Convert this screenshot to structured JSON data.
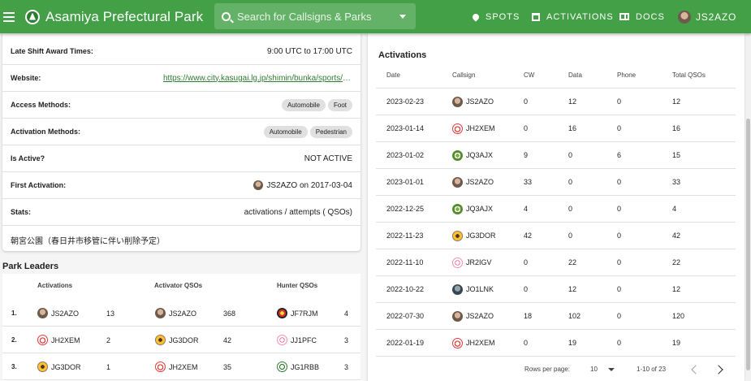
{
  "appbar": {
    "title": "Asamiya Prefectural Park",
    "search_placeholder": "Search for Callsigns & Parks",
    "nav": {
      "spots": "SPOTS",
      "activations": "ACTIVATIONS",
      "docs": "DOCS",
      "user": "JS2AZO"
    }
  },
  "details": {
    "rows": [
      {
        "label": "Late Shift Award Times:",
        "value": "9:00 UTC to 17:00 UTC"
      },
      {
        "label": "Website:",
        "link": "https://www.city.kasugai.lg.jp/shimin/bunka/sports/asamiya/index.html"
      },
      {
        "label": "Access Methods:",
        "chips": [
          "Automobile",
          "Foot"
        ]
      },
      {
        "label": "Activation Methods:",
        "chips": [
          "Automobile",
          "Pedestrian"
        ]
      },
      {
        "label": "Is Active?",
        "value": "NOT ACTIVE"
      },
      {
        "label": "First Activation:",
        "value": "JS2AZO on 2017-03-04"
      },
      {
        "label": "Stats:",
        "value": "activations / attempts ( QSOs)"
      }
    ],
    "note": "朝宮公園（春日井市移管に伴い削除予定）"
  },
  "leaders": {
    "title": "Park Leaders",
    "headers": {
      "activations": "Activations",
      "activator_qsos": "Activator QSOs",
      "hunter_qsos": "Hunter QSOs"
    },
    "rows": [
      {
        "rank": "1.",
        "act_call": "JS2AZO",
        "act_icon": "av-photo",
        "act_count": "13",
        "aq_call": "JS2AZO",
        "aq_icon": "av-photo",
        "aq_count": "368",
        "hq_call": "JF7RJM",
        "hq_icon": "av-dark",
        "hq_count": "4"
      },
      {
        "rank": "2.",
        "act_call": "JH2XEM",
        "act_icon": "av-red",
        "act_count": "2",
        "aq_call": "JG3DOR",
        "aq_icon": "av-gold",
        "aq_count": "42",
        "hq_call": "JJ1PFC",
        "hq_icon": "av-pink",
        "hq_count": "3"
      },
      {
        "rank": "3.",
        "act_call": "JG3DOR",
        "act_icon": "av-gold",
        "act_count": "1",
        "aq_call": "JH2XEM",
        "aq_icon": "av-red",
        "aq_count": "35",
        "hq_call": "JG1RBB",
        "hq_icon": "av-teal",
        "hq_count": "3"
      }
    ]
  },
  "activations": {
    "title": "Activations",
    "headers": {
      "date": "Date",
      "callsign": "Callsign",
      "cw": "CW",
      "data": "Data",
      "phone": "Phone",
      "total": "Total QSOs"
    },
    "rows": [
      {
        "date": "2023-02-23",
        "call": "JS2AZO",
        "icon": "av-photo",
        "cw": "0",
        "data": "12",
        "phone": "0",
        "total": "12"
      },
      {
        "date": "2023-01-14",
        "call": "JH2XEM",
        "icon": "av-red",
        "cw": "0",
        "data": "16",
        "phone": "0",
        "total": "16"
      },
      {
        "date": "2023-01-02",
        "call": "JQ3AJX",
        "icon": "av-green",
        "cw": "9",
        "data": "0",
        "phone": "6",
        "total": "15"
      },
      {
        "date": "2023-01-01",
        "call": "JS2AZO",
        "icon": "av-photo",
        "cw": "33",
        "data": "0",
        "phone": "0",
        "total": "33"
      },
      {
        "date": "2022-12-25",
        "call": "JQ3AJX",
        "icon": "av-green",
        "cw": "4",
        "data": "0",
        "phone": "0",
        "total": "4"
      },
      {
        "date": "2022-11-23",
        "call": "JG3DOR",
        "icon": "av-gold",
        "cw": "42",
        "data": "0",
        "phone": "0",
        "total": "42"
      },
      {
        "date": "2022-11-10",
        "call": "JR2IGV",
        "icon": "av-pink",
        "cw": "0",
        "data": "22",
        "phone": "0",
        "total": "22"
      },
      {
        "date": "2022-10-22",
        "call": "JO1LNK",
        "icon": "av-blue",
        "cw": "0",
        "data": "12",
        "phone": "0",
        "total": "12"
      },
      {
        "date": "2022-07-30",
        "call": "JS2AZO",
        "icon": "av-photo",
        "cw": "18",
        "data": "102",
        "phone": "0",
        "total": "120"
      },
      {
        "date": "2022-01-19",
        "call": "JH2XEM",
        "icon": "av-red",
        "cw": "0",
        "data": "19",
        "phone": "0",
        "total": "19"
      }
    ],
    "footer": {
      "rows_per_page_label": "Rows per page:",
      "rows_per_page": "10",
      "range": "1-10 of 23"
    }
  }
}
